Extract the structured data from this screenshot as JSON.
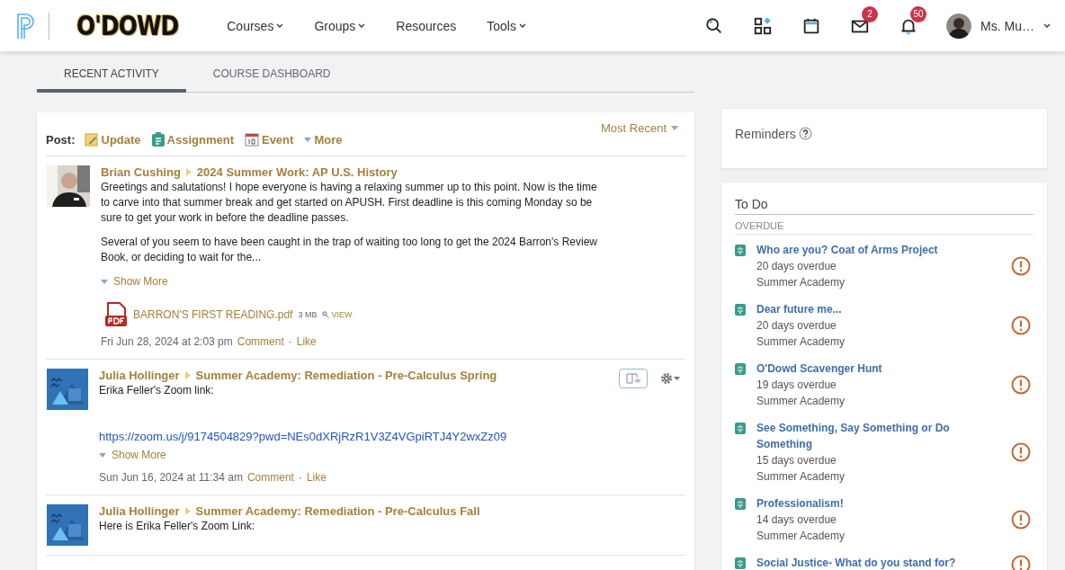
{
  "header": {
    "school_logo": "O'DOWD",
    "menu": [
      {
        "label": "Courses",
        "dropdown": true
      },
      {
        "label": "Groups",
        "dropdown": true
      },
      {
        "label": "Resources",
        "dropdown": false
      },
      {
        "label": "Tools",
        "dropdown": true
      }
    ],
    "icons": [
      {
        "kind": "search"
      },
      {
        "kind": "apps"
      },
      {
        "kind": "calendar"
      },
      {
        "kind": "mail",
        "badge": "2"
      },
      {
        "kind": "bell",
        "badge": "50"
      }
    ],
    "user_name": "Ms. Mu…"
  },
  "tabs": [
    {
      "label": "RECENT ACTIVITY",
      "selected": true
    },
    {
      "label": "COURSE DASHBOARD",
      "selected": false
    }
  ],
  "post_bar": {
    "label": "Post:",
    "actions": [
      {
        "label": "Update",
        "kind": "update"
      },
      {
        "label": "Assignment",
        "kind": "assignment"
      },
      {
        "label": "Event",
        "kind": "event"
      },
      {
        "label": "More",
        "kind": "more"
      }
    ],
    "sort": "Most Recent"
  },
  "posts": [
    {
      "author": "Brian Cushing",
      "course": "2024 Summer Work: AP U.S. History",
      "tools": false,
      "paragraphs": [
        "Greetings and salutations! I hope everyone is having a relaxing summer up to this point. Now is the time to carve into that summer break and get started on APUSH. First deadline is this coming Monday so be sure to get your work in before the deadline passes.",
        "Several of you seem to have been caught in the trap of waiting too long to get the 2024 Barron's Review Book, or deciding to wait for the..."
      ],
      "show_more": "Show More",
      "attachment": {
        "name": "BARRON'S FIRST READING.pdf",
        "size": "3 MB",
        "view": "VIEW"
      },
      "timestamp": "Fri Jun 28, 2024 at 2:03 pm",
      "actions": [
        "Comment",
        "Like"
      ],
      "separator": "·"
    },
    {
      "kind": "course",
      "author": "Julia Hollinger",
      "course": "Summer Academy: Remediation - Pre-Calculus Spring",
      "tools": true,
      "paragraphs": [
        "Erika Feller's Zoom link:"
      ],
      "link": "https://zoom.us/j/9174504829?pwd=NEs0dXRjRzR1V3Z4VGpiRTJ4Y2wxZz09",
      "show_more": "Show More",
      "timestamp": "Sun Jun 16, 2024 at 11:34 am",
      "actions": [
        "Comment",
        "Like"
      ],
      "separator": "·"
    },
    {
      "kind": "course",
      "author": "Julia Hollinger",
      "course": "Summer Academy: Remediation - Pre-Calculus Fall",
      "tools": false,
      "paragraphs": [
        "Here is Erika Feller's Zoom Link:"
      ]
    }
  ],
  "reminders": {
    "title": "Reminders"
  },
  "todo": {
    "title": "To Do",
    "section": "OVERDUE",
    "items": [
      {
        "title": "Who are you? Coat of Arms Project",
        "overdue": "20 days overdue",
        "course": "Summer Academy"
      },
      {
        "title": "Dear future me...",
        "overdue": "20 days overdue",
        "course": "Summer Academy"
      },
      {
        "title": "O'Dowd Scavenger Hunt",
        "overdue": "19 days overdue",
        "course": "Summer Academy"
      },
      {
        "title": "See Something, Say Something or Do Something",
        "overdue": "15 days overdue",
        "course": "Summer Academy"
      },
      {
        "title": "Professionalism!",
        "overdue": "14 days overdue",
        "course": "Summer Academy"
      },
      {
        "title": "Social Justice- What do you stand for?"
      }
    ]
  }
}
